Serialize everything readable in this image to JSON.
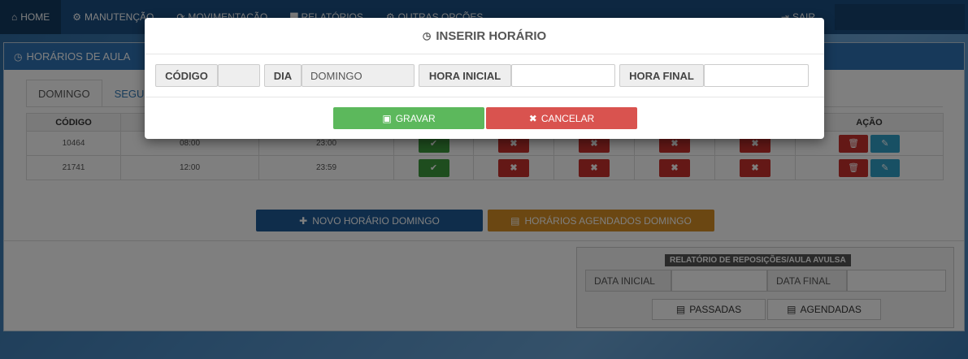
{
  "navbar": {
    "items": [
      {
        "label": "HOME",
        "icon": "home-icon",
        "glyph": "⌂"
      },
      {
        "label": "MANUTENÇÃO",
        "icon": "gear-icon",
        "glyph": "⚙"
      },
      {
        "label": "MOVIMENTAÇÃO",
        "icon": "refresh-icon",
        "glyph": "⟳"
      },
      {
        "label": "RELATÓRIOS",
        "icon": "file-icon",
        "glyph": "▇"
      },
      {
        "label": "OUTRAS OPÇÕES",
        "icon": "gears-icon",
        "glyph": "⚙"
      }
    ],
    "logout": {
      "label": "SAIR",
      "icon": "logout-icon",
      "glyph": "⇥"
    }
  },
  "panel": {
    "title": "HORÁRIOS DE AULA",
    "tabs": [
      {
        "label": "DOMINGO"
      },
      {
        "label": "SEGU"
      }
    ],
    "table": {
      "headers": [
        "CÓDIGO",
        "",
        "",
        "",
        "",
        "",
        "",
        "",
        "AÇÃO"
      ],
      "rows": [
        {
          "codigo": "10464",
          "inicio": "08:00",
          "fim": "23:00"
        },
        {
          "codigo": "21741",
          "inicio": "12:00",
          "fim": "23:59"
        }
      ]
    },
    "novo_button": "NOVO HORÁRIO DOMINGO",
    "agendados_button": "HORÁRIOS AGENDADOS DOMINGO"
  },
  "report": {
    "title": "RELATÓRIO DE REPOSIÇÕES/AULA AVULSA",
    "data_inicial_label": "DATA INICIAL",
    "data_final_label": "DATA FINAL",
    "passadas_button": "PASSADAS",
    "agendadas_button": "AGENDADAS"
  },
  "modal": {
    "title": "INSERIR HORÁRIO",
    "codigo_label": "CÓDIGO",
    "codigo_value": "",
    "dia_label": "DIA",
    "dia_value": "DOMINGO",
    "hora_inicial_label": "HORA INICIAL",
    "hora_inicial_value": "",
    "hora_final_label": "HORA FINAL",
    "hora_final_value": "",
    "save_button": "GRAVAR",
    "cancel_button": "CANCELAR"
  },
  "colors": {
    "navbar": "#1b4f82",
    "panel_header": "#2f73b5",
    "save": "#5cb85c",
    "cancel": "#d9534f",
    "novo": "#1f5b97",
    "agendados": "#d68f24"
  }
}
